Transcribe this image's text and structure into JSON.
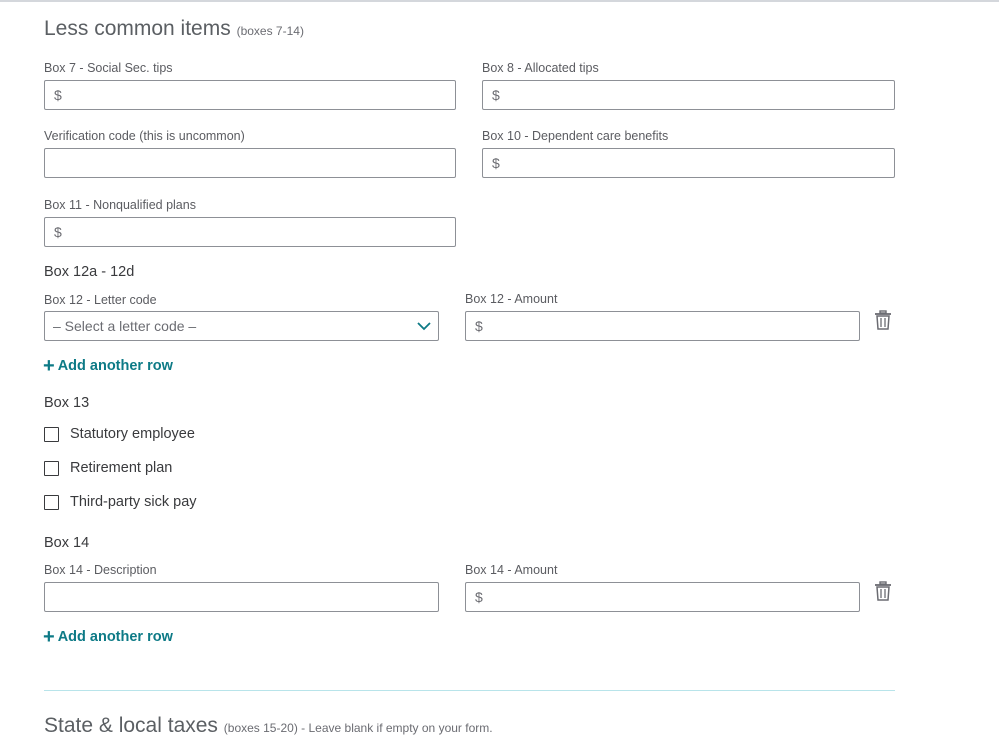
{
  "less_common": {
    "title": "Less common items",
    "subtitle": "(boxes 7-14)",
    "box7": {
      "label": "Box 7 - Social Sec. tips",
      "prefix": "$",
      "value": ""
    },
    "box8": {
      "label": "Box 8 - Allocated tips",
      "prefix": "$",
      "value": ""
    },
    "verification": {
      "label": "Verification code (this is uncommon)",
      "value": ""
    },
    "box10": {
      "label": "Box 10 - Dependent care benefits",
      "prefix": "$",
      "value": ""
    },
    "box11": {
      "label": "Box 11 - Nonqualified plans",
      "prefix": "$",
      "value": ""
    }
  },
  "box12": {
    "group_label": "Box 12a - 12d",
    "letter_code_label": "Box 12 - Letter code",
    "letter_code_placeholder": "– Select a letter code –",
    "amount_label": "Box 12 - Amount",
    "amount_prefix": "$",
    "amount_value": "",
    "add_row_label": "Add another row"
  },
  "box13": {
    "group_label": "Box 13",
    "options": [
      {
        "label": "Statutory employee",
        "checked": false
      },
      {
        "label": "Retirement plan",
        "checked": false
      },
      {
        "label": "Third-party sick pay",
        "checked": false
      }
    ]
  },
  "box14": {
    "group_label": "Box 14",
    "description_label": "Box 14 - Description",
    "description_value": "",
    "amount_label": "Box 14 - Amount",
    "amount_prefix": "$",
    "amount_value": "",
    "add_row_label": "Add another row"
  },
  "state_local": {
    "title": "State & local taxes",
    "subtitle": "(boxes 15-20) - Leave blank if empty on your form."
  },
  "icons": {
    "dropdown": "chevron-down-icon",
    "delete": "trash-icon",
    "add": "plus-icon"
  },
  "colors": {
    "accent": "#0d7a86",
    "field_border": "#8d9096",
    "divider": "#b8e4ea"
  }
}
